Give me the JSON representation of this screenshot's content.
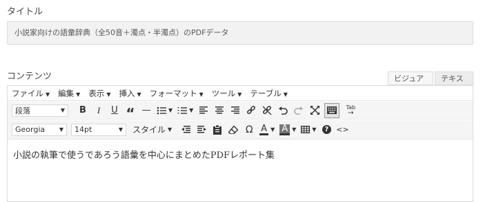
{
  "title_field": {
    "label": "タイトル",
    "value": "小説家向けの語彙辞典（全50音＋濁点・半濁点）のPDFデータ"
  },
  "content_field": {
    "label": "コンテンツ"
  },
  "editor_tabs": {
    "visual": "ビジュアル",
    "text": "テキスト"
  },
  "menubar": [
    "ファイル",
    "編集",
    "表示",
    "挿入",
    "フォーマット",
    "ツール",
    "テーブル"
  ],
  "toolbar1": {
    "format_select": "段落",
    "bold": "B",
    "italic": "I",
    "underline": "U",
    "quote": "“",
    "hr": "—",
    "tab_icon_label": "Tab"
  },
  "toolbar2": {
    "font_select": "Georgia",
    "size_select": "14pt",
    "styles_label": "スタイル",
    "omega": "Ω",
    "text_color_letter": "A",
    "bg_color_letter": "A",
    "help": "?",
    "code": "<>"
  },
  "editor_body": "小説の執筆で使うであろう語彙を中心にまとめたPDFレポート集"
}
